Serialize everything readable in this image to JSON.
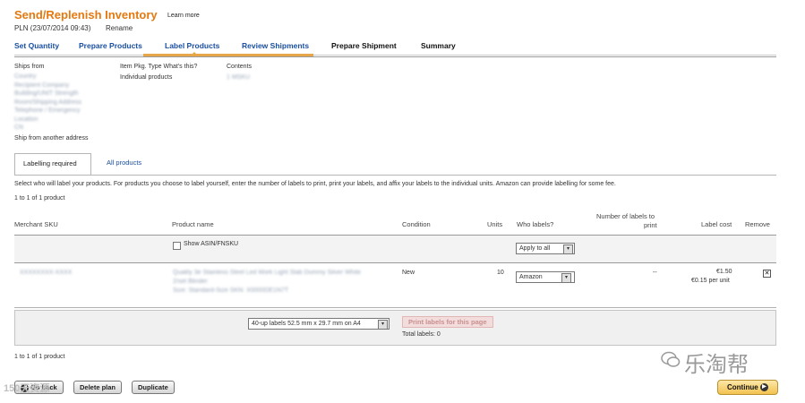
{
  "header": {
    "title": "Send/Replenish Inventory",
    "learn_more": "Learn more",
    "subtitle": "PLN (23/07/2014 09:43)",
    "rename": "Rename"
  },
  "steps": [
    {
      "label": "Set Quantity"
    },
    {
      "label": "Prepare Products"
    },
    {
      "label": "Label Products"
    },
    {
      "label": "Review Shipments"
    },
    {
      "label": "Prepare Shipment"
    },
    {
      "label": "Summary"
    }
  ],
  "info": {
    "ships_from_label": "Ships from",
    "ships_from_lines": [
      "Country",
      "Recipient Company",
      "Building/UNIT Strength",
      "Room/Shipping Address",
      "Telephone / Emergency",
      "Location",
      "CN"
    ],
    "ship_other_address": "Ship from another address",
    "packing_type_label": "Item Pkg. Type What's this?",
    "packing_type_value": "Individual products",
    "contents_label": "Contents",
    "contents_value": "1 MSKU"
  },
  "tabs": {
    "labelling_required": "Labelling required",
    "all_products": "All products"
  },
  "description": "Select who will label your products. For products you choose to label yourself, enter the number of labels to print, print your labels, and affix your labels to the individual units. Amazon can provide labelling for some fee.",
  "count_top": "1 to 1 of 1 product",
  "count_bottom": "1 to 1 of 1 product",
  "table": {
    "headers": {
      "sku": "Merchant SKU",
      "name": "Product name",
      "condition": "Condition",
      "units": "Units",
      "who_labels": "Who labels?",
      "num_labels_1": "Number of labels to",
      "num_labels_2": "print",
      "label_cost": "Label cost",
      "remove": "Remove"
    },
    "filter": {
      "show_asin": "Show ASIN/FNSKU",
      "apply_to_all": "Apply to all"
    },
    "rows": [
      {
        "sku": "XXXXXXXX-XXXX",
        "name_1": "Quality 3e Stainless Steel Led Work Light Slab Dummy Silver White",
        "name_2": "2/set Blinder",
        "name_3": "Size: Standard-Size SKN: X0000DE1N7T",
        "condition": "New",
        "units": "10",
        "who_labels": "Amazon",
        "num_labels": "--",
        "label_cost_1": "€1.50",
        "label_cost_2": "€0.15 per unit",
        "remove": "✕"
      }
    ]
  },
  "footer": {
    "label_size": "40-up labels 52.5 mm x 29.7 mm on A4",
    "print_button": "Print labels for this page",
    "total_labels": "Total labels: 0"
  },
  "buttons": {
    "go_back": "Go back",
    "delete_plan": "Delete plan",
    "duplicate": "Duplicate",
    "continue": "Continue"
  },
  "watermark": {
    "text": "乐淘帮",
    "small": "150天资源"
  },
  "colors": {
    "title": "#e47911",
    "link": "#1a4fa0",
    "accent_underline": "#e8a64a",
    "continue_button": "#f2c24f"
  }
}
